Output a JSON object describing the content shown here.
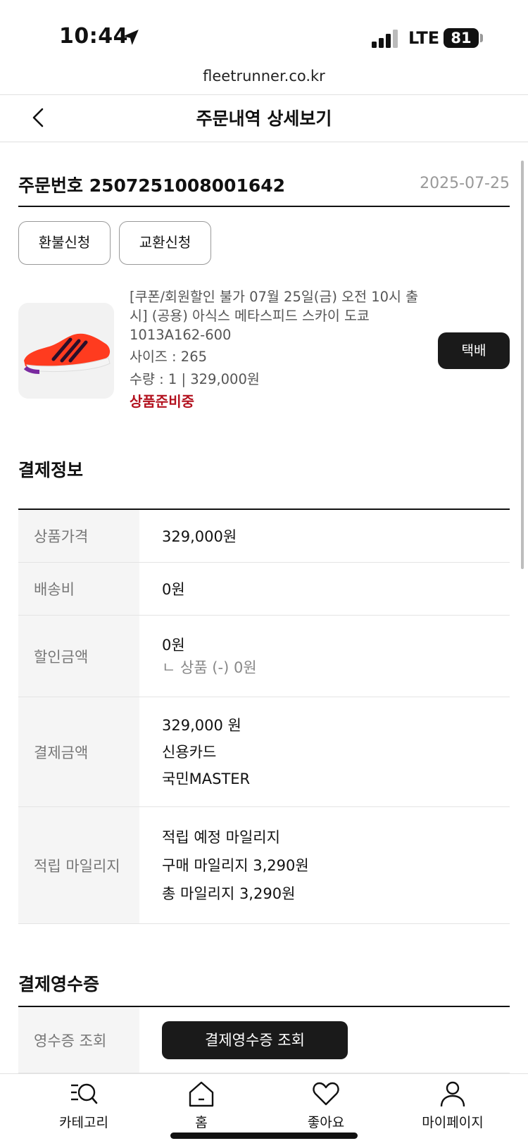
{
  "status_bar": {
    "time": "10:44",
    "network": "LTE",
    "battery": "81"
  },
  "browser": {
    "url": "fleetrunner.co.kr"
  },
  "header": {
    "title": "주문내역 상세보기"
  },
  "order": {
    "number_label": "주문번호 2507251008001642",
    "date": "2025-07-25",
    "refund_button": "환불신청",
    "exchange_button": "교환신청"
  },
  "product": {
    "name_lines": [
      "[쿠폰/회원할인 불가 07월 25일(금) 오전 10시 출",
      "시] (공용) 아식스 메타스피드 스카이 도쿄",
      "1013A162-600"
    ],
    "size": "사이즈 : 265",
    "quantity_price": "수량 : 1 | 329,000원",
    "status": "상품준비중",
    "delivery_button": "택배",
    "accent_color": "#b3121f"
  },
  "payment": {
    "title": "결제정보",
    "rows": [
      {
        "label": "상품가격",
        "values": [
          "329,000원"
        ]
      },
      {
        "label": "배송비",
        "values": [
          "0원"
        ]
      },
      {
        "label": "할인금액",
        "values": [
          "0원"
        ],
        "sub": "ㄴ 상품 (-) 0원"
      },
      {
        "label": "결제금액",
        "values": [
          "329,000 원",
          "신용카드",
          "국민MASTER"
        ]
      },
      {
        "label": "적립 마일리지",
        "values": [
          "적립 예정 마일리지",
          "구매 마일리지 3,290원",
          "총 마일리지 3,290원"
        ]
      }
    ]
  },
  "receipt": {
    "title": "결제영수증",
    "label": "영수증 조회",
    "button": "결제영수증 조회"
  },
  "bottom_nav": [
    {
      "label": "카테고리",
      "icon": "category-search-icon"
    },
    {
      "label": "홈",
      "icon": "home-icon"
    },
    {
      "label": "좋아요",
      "icon": "heart-icon"
    },
    {
      "label": "마이페이지",
      "icon": "user-icon"
    }
  ]
}
